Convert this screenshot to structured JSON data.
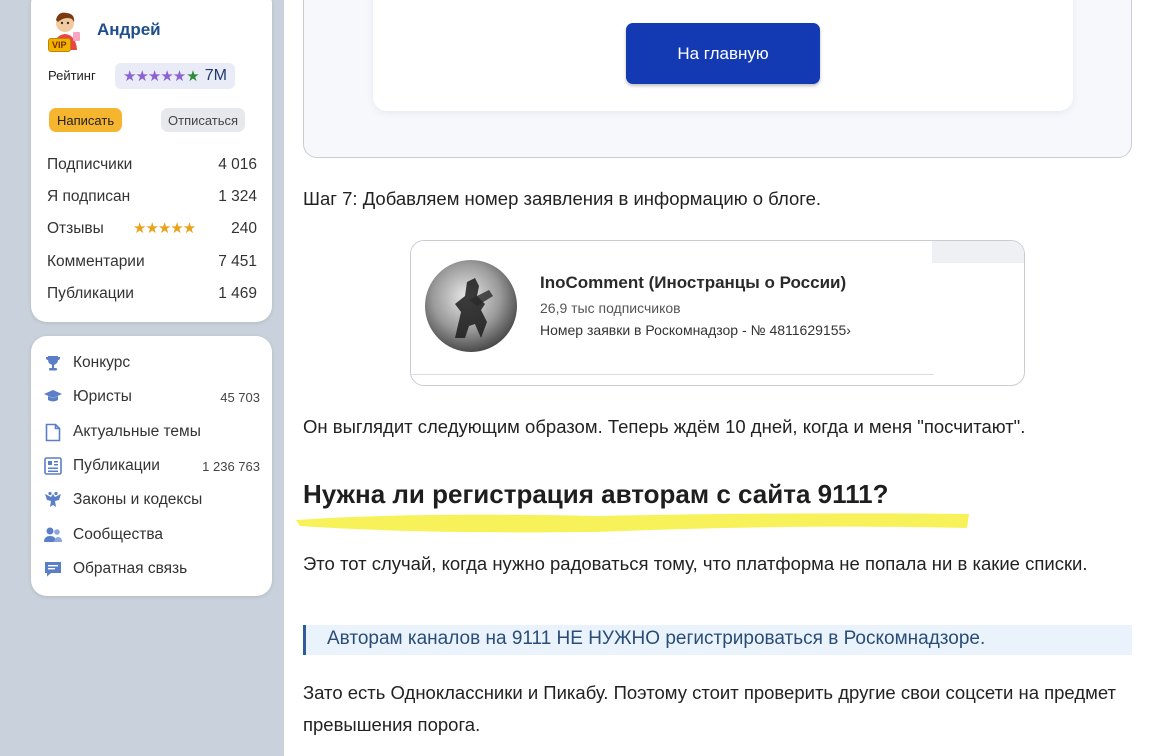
{
  "profile": {
    "name": "Андрей",
    "vip_badge": "VIP",
    "rating_label": "Рейтинг",
    "rating_stars_purple": "★★★★★",
    "rating_star_green": "★",
    "rating_value": "7M",
    "write_button": "Написать",
    "unsubscribe_button": "Отписаться",
    "stats": [
      {
        "label": "Подписчики",
        "value": "4 016"
      },
      {
        "label": "Я подписан",
        "value": "1 324"
      },
      {
        "label": "Отзывы",
        "value": "240",
        "stars": "★★★★★"
      },
      {
        "label": "Комментарии",
        "value": "7 451"
      },
      {
        "label": "Публикации",
        "value": "1 469"
      }
    ]
  },
  "nav": {
    "items": [
      {
        "label": "Конкурс",
        "icon": "trophy-icon",
        "count": ""
      },
      {
        "label": "Юристы",
        "icon": "graduation-cap-icon",
        "count": "45 703"
      },
      {
        "label": "Актуальные темы",
        "icon": "document-icon",
        "count": ""
      },
      {
        "label": "Публикации",
        "icon": "newspaper-icon",
        "count": "1 236 763"
      },
      {
        "label": "Законы и кодексы",
        "icon": "eagle-emblem-icon",
        "count": ""
      },
      {
        "label": "Сообщества",
        "icon": "people-icon",
        "count": ""
      },
      {
        "label": "Обратная связь",
        "icon": "chat-icon",
        "count": ""
      }
    ]
  },
  "article": {
    "home_button": "На главную",
    "step7": "Шаг 7: Добавляем номер заявления в информацию о блоге.",
    "channel": {
      "name": "InoComment (Иностранцы о России)",
      "subscribers": "26,9 тыс подписчиков",
      "application": "Номер заявки в Роскомнадзор - № 4811629155",
      "chevron": "›"
    },
    "after_card": "Он выглядит следующим образом. Теперь ждём 10 дней, когда и меня \"посчитают\".",
    "heading": "Нужна ли регистрация авторам с сайта 9111?",
    "p_case": "Это тот случай, когда нужно радоваться тому, что платформа не попала ни в какие списки.",
    "quote": "Авторам каналов на 9111 НЕ НУЖНО регистрироваться в Роскомнадзоре.",
    "p_ok": "Зато есть Одноклассники и Пикабу. Поэтому стоит проверить другие свои соцсети на предмет превышения порога."
  },
  "colors": {
    "accent_blue": "#1339b3",
    "write_button": "#f5b52e",
    "highlighter": "#f7f25a",
    "name_blue": "#1f4e8c"
  }
}
